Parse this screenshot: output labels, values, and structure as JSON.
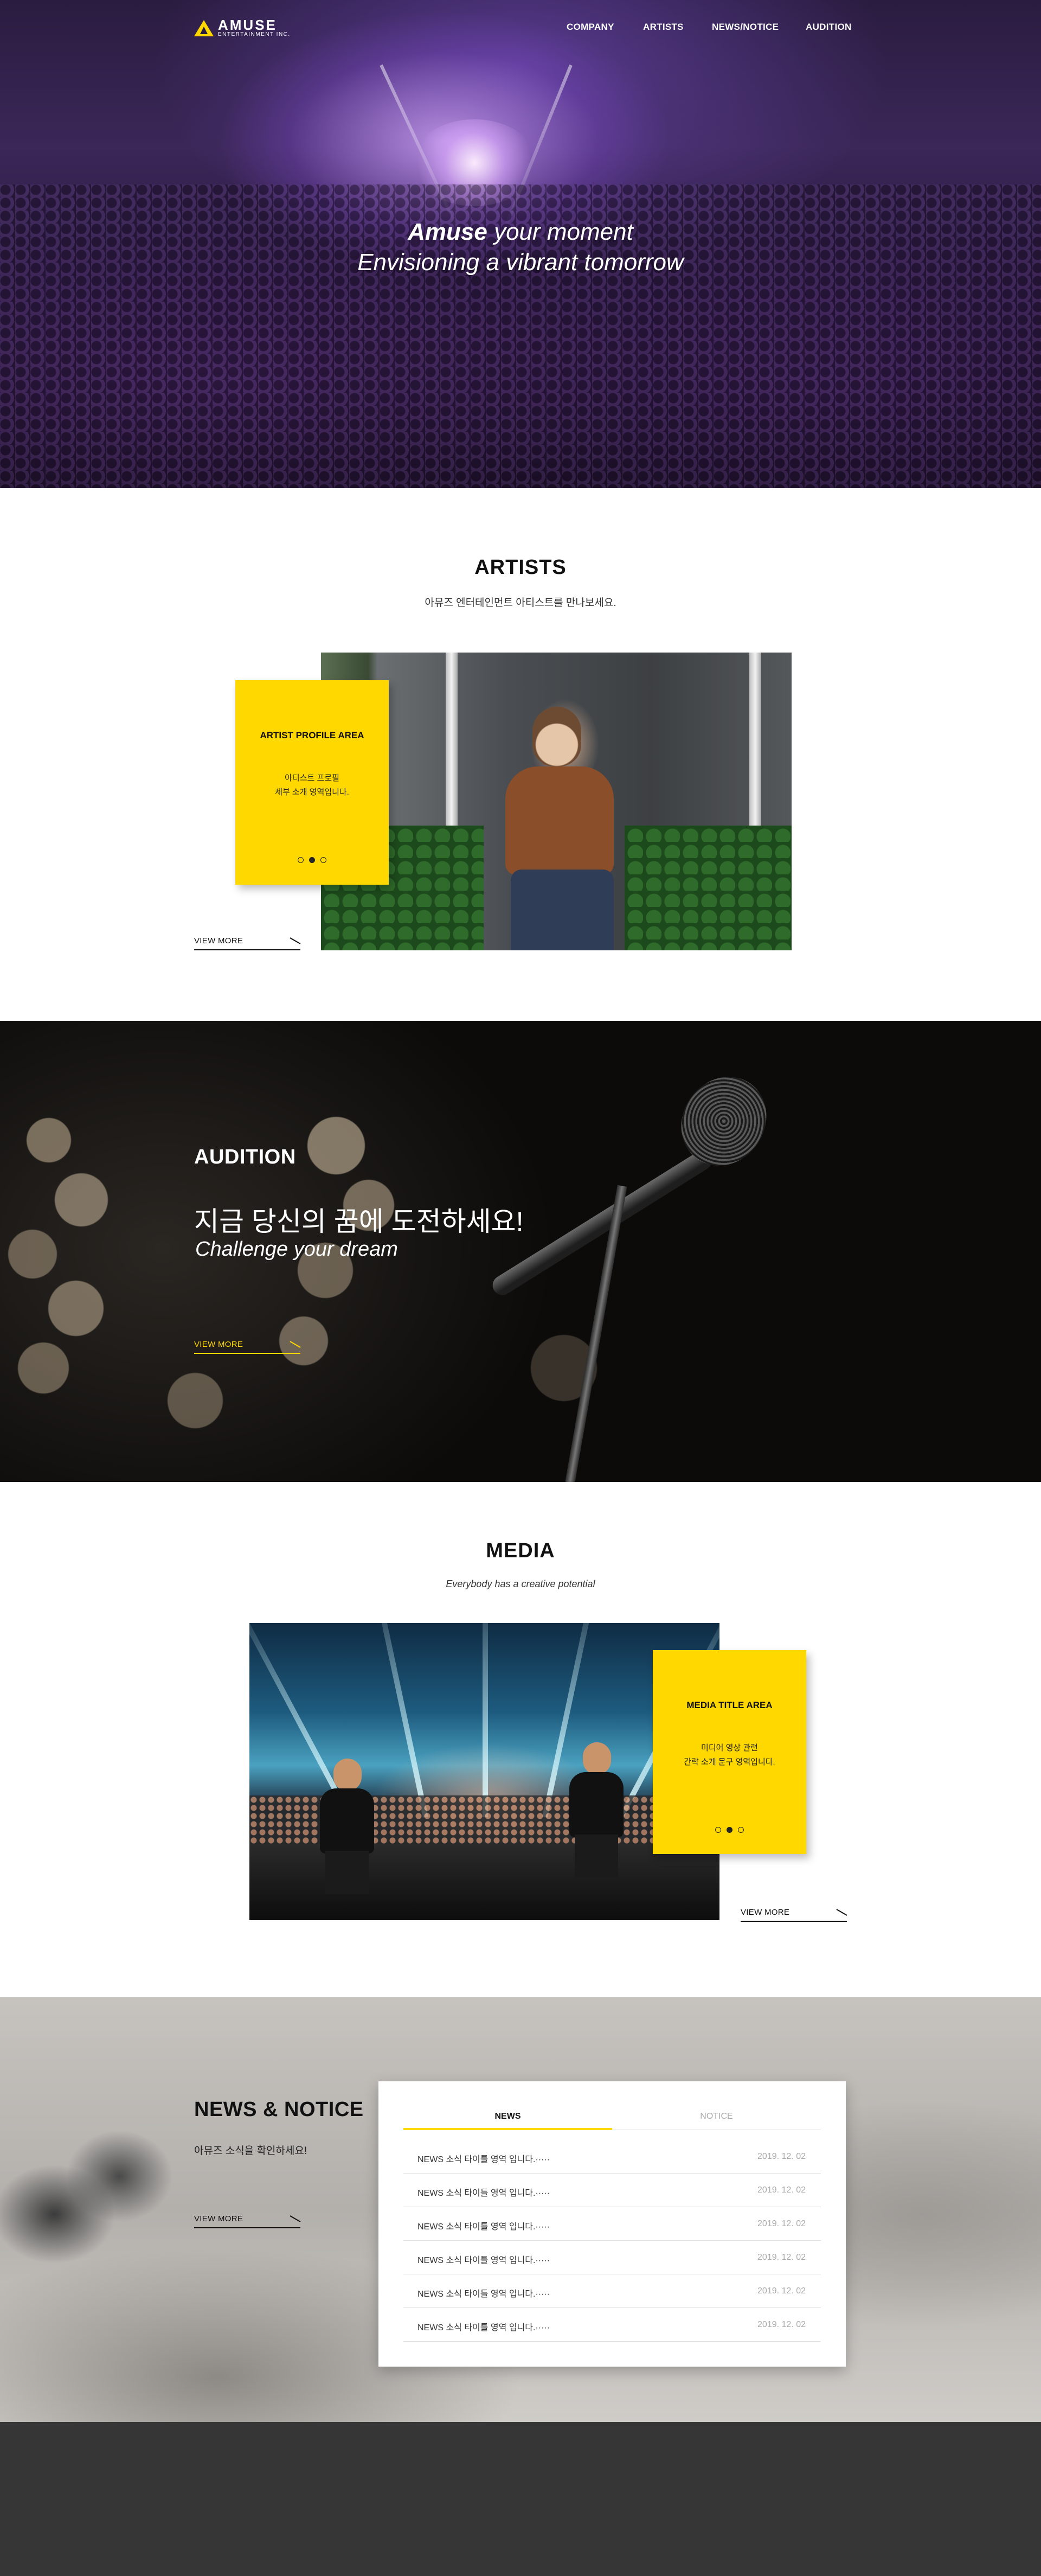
{
  "nav": {
    "logo_text": "AMUSE",
    "logo_sub": "ENTERTAINMENT INC.",
    "menu": [
      "COMPANY",
      "ARTISTS",
      "NEWS/NOTICE",
      "AUDITION"
    ]
  },
  "hero": {
    "line1_bold": "Amuse",
    "line1_rest": " your moment",
    "line2": "Envisioning a vibrant tomorrow"
  },
  "artists": {
    "title": "ARTISTS",
    "subtitle": "아뮤즈 엔터테인먼트 아티스트를 만나보세요.",
    "card_title": "ARTIST PROFILE AREA",
    "card_desc_1": "아티스트 프로필",
    "card_desc_2": "세부 소개 영역입니다.",
    "view_more": "VIEW MORE"
  },
  "audition": {
    "label": "AUDITION",
    "headline_ko": "지금 당신의 꿈에 도전하세요!",
    "headline_en": "Challenge your dream",
    "view_more": "VIEW MORE"
  },
  "media": {
    "title": "MEDIA",
    "subtitle": "Everybody has a creative potential",
    "card_title": "MEDIA TITLE AREA",
    "card_desc_1": "미디어 영상 관련",
    "card_desc_2": "간략 소개 문구 영역입니다.",
    "view_more": "VIEW MORE"
  },
  "news": {
    "title": "NEWS & NOTICE",
    "subtitle": "아뮤즈 소식을 확인하세요!",
    "view_more": "VIEW MORE",
    "tabs": [
      "NEWS",
      "NOTICE"
    ],
    "items": [
      {
        "title": "NEWS 소식 타이틀 영역 입니다.·····",
        "date": "2019. 12. 02"
      },
      {
        "title": "NEWS 소식 타이틀 영역 입니다.·····",
        "date": "2019. 12. 02"
      },
      {
        "title": "NEWS 소식 타이틀 영역 입니다.·····",
        "date": "2019. 12. 02"
      },
      {
        "title": "NEWS 소식 타이틀 영역 입니다.·····",
        "date": "2019. 12. 02"
      },
      {
        "title": "NEWS 소식 타이틀 영역 입니다.·····",
        "date": "2019. 12. 02"
      },
      {
        "title": "NEWS 소식 타이틀 영역 입니다.·····",
        "date": "2019. 12. 02"
      }
    ]
  },
  "colors": {
    "accent": "#ffd800",
    "footer": "#363636"
  }
}
